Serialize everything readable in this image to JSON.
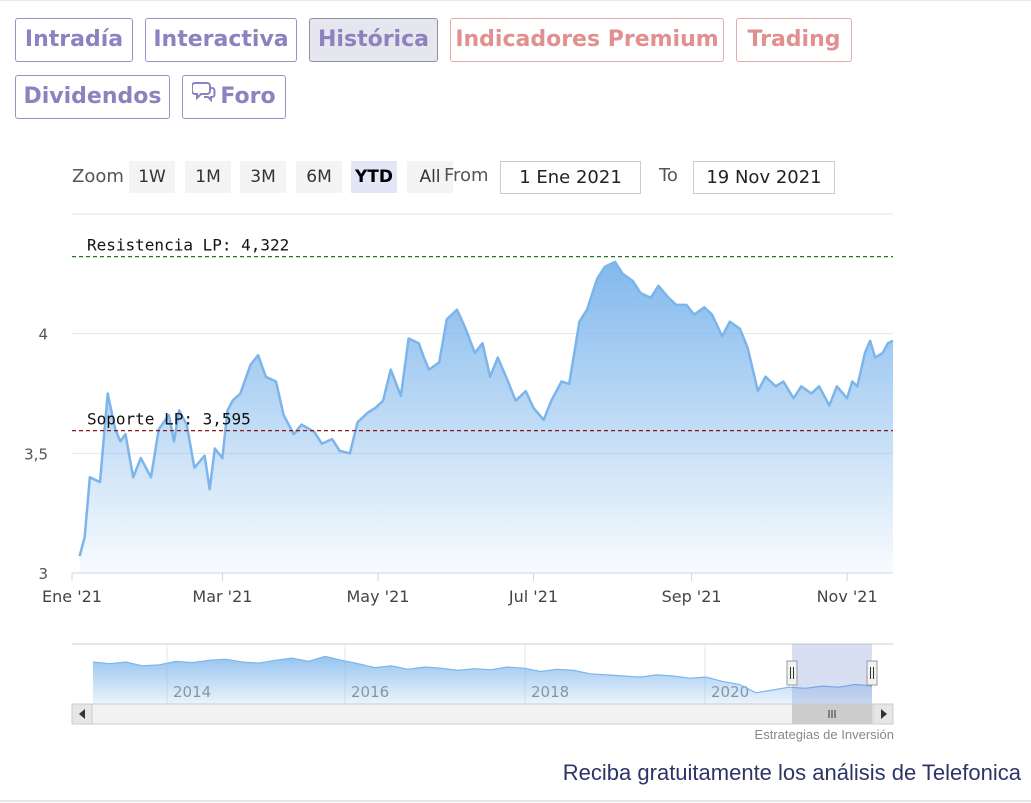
{
  "tabs": [
    {
      "label": "Intradía"
    },
    {
      "label": "Interactiva"
    },
    {
      "label": "Histórica"
    },
    {
      "label": "Indicadores Premium"
    },
    {
      "label": "Trading"
    },
    {
      "label": "Dividendos"
    },
    {
      "label": "Foro"
    }
  ],
  "active_tab": "Histórica",
  "range_selector": {
    "zoom_label": "Zoom",
    "buttons": [
      "1W",
      "1M",
      "3M",
      "6M",
      "YTD",
      "All"
    ],
    "active": "YTD",
    "from_label": "From",
    "from_value": "1 Ene 2021",
    "to_label": "To",
    "to_value": "19 Nov 2021"
  },
  "chart_data": {
    "type": "area",
    "title": "",
    "xlabel": "",
    "ylabel": "",
    "x_range": [
      "2021-01-01",
      "2021-11-19"
    ],
    "ylim": [
      3,
      4.5
    ],
    "y_ticks": [
      {
        "value": 3,
        "label": "3"
      },
      {
        "value": 3.5,
        "label": "3,5"
      },
      {
        "value": 4,
        "label": "4"
      }
    ],
    "x_ticks": [
      {
        "date": "2021-01-01",
        "label": "Ene '21"
      },
      {
        "date": "2021-03-01",
        "label": "Mar '21"
      },
      {
        "date": "2021-05-01",
        "label": "May '21"
      },
      {
        "date": "2021-07-01",
        "label": "Jul '21"
      },
      {
        "date": "2021-09-01",
        "label": "Sep '21"
      },
      {
        "date": "2021-11-01",
        "label": "Nov '21"
      }
    ],
    "grid": true,
    "series": [
      {
        "x": [
          "2021-01-04",
          "2021-01-06",
          "2021-01-08",
          "2021-01-12",
          "2021-01-15",
          "2021-01-18",
          "2021-01-20",
          "2021-01-22",
          "2021-01-25",
          "2021-01-28",
          "2021-02-01",
          "2021-02-04",
          "2021-02-08",
          "2021-02-10",
          "2021-02-12",
          "2021-02-15",
          "2021-02-18",
          "2021-02-22",
          "2021-02-24",
          "2021-02-26",
          "2021-03-01",
          "2021-03-03",
          "2021-03-05",
          "2021-03-08",
          "2021-03-12",
          "2021-03-15",
          "2021-03-18",
          "2021-03-22",
          "2021-03-25",
          "2021-03-29",
          "2021-04-01",
          "2021-04-06",
          "2021-04-09",
          "2021-04-13",
          "2021-04-16",
          "2021-04-20",
          "2021-04-23",
          "2021-04-27",
          "2021-04-30",
          "2021-05-03",
          "2021-05-06",
          "2021-05-10",
          "2021-05-13",
          "2021-05-17",
          "2021-05-19",
          "2021-05-21",
          "2021-05-25",
          "2021-05-28",
          "2021-06-01",
          "2021-06-04",
          "2021-06-08",
          "2021-06-11",
          "2021-06-14",
          "2021-06-17",
          "2021-06-21",
          "2021-06-24",
          "2021-06-28",
          "2021-07-01",
          "2021-07-05",
          "2021-07-08",
          "2021-07-12",
          "2021-07-15",
          "2021-07-19",
          "2021-07-22",
          "2021-07-26",
          "2021-07-29",
          "2021-08-02",
          "2021-08-05",
          "2021-08-09",
          "2021-08-12",
          "2021-08-16",
          "2021-08-19",
          "2021-08-23",
          "2021-08-26",
          "2021-08-30",
          "2021-09-02",
          "2021-09-06",
          "2021-09-09",
          "2021-09-13",
          "2021-09-16",
          "2021-09-20",
          "2021-09-23",
          "2021-09-27",
          "2021-09-30",
          "2021-10-04",
          "2021-10-07",
          "2021-10-11",
          "2021-10-14",
          "2021-10-18",
          "2021-10-21",
          "2021-10-25",
          "2021-10-28",
          "2021-11-01",
          "2021-11-03",
          "2021-11-05",
          "2021-11-08",
          "2021-11-10",
          "2021-11-12",
          "2021-11-15",
          "2021-11-17",
          "2021-11-19"
        ],
        "y": [
          3.07,
          3.15,
          3.4,
          3.38,
          3.75,
          3.6,
          3.55,
          3.58,
          3.4,
          3.48,
          3.4,
          3.6,
          3.66,
          3.55,
          3.68,
          3.62,
          3.44,
          3.49,
          3.35,
          3.52,
          3.48,
          3.68,
          3.72,
          3.75,
          3.87,
          3.91,
          3.82,
          3.8,
          3.66,
          3.58,
          3.62,
          3.59,
          3.54,
          3.56,
          3.51,
          3.5,
          3.63,
          3.67,
          3.69,
          3.72,
          3.85,
          3.74,
          3.98,
          3.96,
          3.9,
          3.85,
          3.88,
          4.06,
          4.1,
          4.03,
          3.92,
          3.96,
          3.82,
          3.9,
          3.8,
          3.72,
          3.76,
          3.69,
          3.64,
          3.72,
          3.8,
          3.79,
          4.05,
          4.1,
          4.23,
          4.28,
          4.3,
          4.25,
          4.22,
          4.17,
          4.15,
          4.2,
          4.15,
          4.12,
          4.12,
          4.08,
          4.11,
          4.08,
          3.99,
          4.05,
          4.02,
          3.94,
          3.76,
          3.82,
          3.78,
          3.8,
          3.73,
          3.78,
          3.75,
          3.78,
          3.7,
          3.78,
          3.73,
          3.8,
          3.78,
          3.92,
          3.97,
          3.9,
          3.92,
          3.96,
          3.97
        ]
      }
    ],
    "plot_lines": [
      {
        "label": "Resistencia LP: 4,322",
        "value": 4.322,
        "color": "#1f7a1f"
      },
      {
        "label": "Soporte LP: 3,595",
        "value": 3.595,
        "color": "#8b1a1a"
      }
    ],
    "line_color": "#7cb5ec",
    "navigator": {
      "x_labels": [
        "2014",
        "2016",
        "2018",
        "2020"
      ],
      "series_y": [
        3.95,
        3.92,
        3.95,
        3.88,
        3.9,
        3.96,
        3.94,
        3.98,
        4.0,
        3.95,
        3.93,
        3.98,
        4.02,
        3.96,
        4.05,
        3.98,
        3.92,
        3.85,
        3.88,
        3.82,
        3.86,
        3.84,
        3.8,
        3.83,
        3.81,
        3.86,
        3.84,
        3.78,
        3.82,
        3.8,
        3.74,
        3.72,
        3.7,
        3.68,
        3.72,
        3.7,
        3.66,
        3.68,
        3.6,
        3.55,
        3.4,
        3.45,
        3.5,
        3.48,
        3.52,
        3.5,
        3.55,
        3.52
      ]
    },
    "credit": "Estrategias de Inversión"
  },
  "cta": "Reciba gratuitamente los análisis de Telefonica"
}
